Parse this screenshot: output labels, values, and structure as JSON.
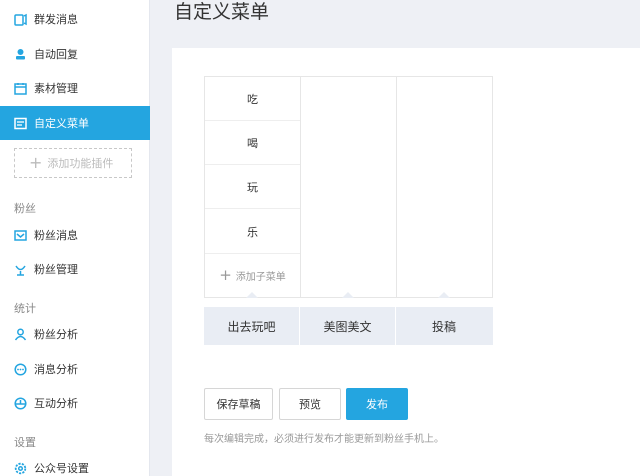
{
  "sidebar": {
    "items": [
      {
        "label": "群发消息",
        "icon": "broadcast-icon"
      },
      {
        "label": "自动回复",
        "icon": "auto-reply-icon"
      },
      {
        "label": "素材管理",
        "icon": "materials-icon"
      },
      {
        "label": "自定义菜单",
        "icon": "custom-menu-icon"
      }
    ],
    "add_plugin_label": "添加功能插件",
    "sections": [
      {
        "label": "粉丝",
        "items": [
          {
            "label": "粉丝消息",
            "icon": "fan-message-icon"
          },
          {
            "label": "粉丝管理",
            "icon": "fan-manage-icon"
          }
        ]
      },
      {
        "label": "统计",
        "items": [
          {
            "label": "粉丝分析",
            "icon": "user-analytics-icon"
          },
          {
            "label": "消息分析",
            "icon": "message-analytics-icon"
          },
          {
            "label": "互动分析",
            "icon": "interaction-analytics-icon"
          }
        ]
      },
      {
        "label": "设置",
        "items": [
          {
            "label": "公众号设置",
            "icon": "account-settings-icon"
          }
        ]
      }
    ],
    "accent": "#24a5e0"
  },
  "header": {
    "title": "自定义菜单"
  },
  "menu": {
    "sub_items": [
      "吃",
      "喝",
      "玩",
      "乐"
    ],
    "add_sub_label": "添加子菜单",
    "top_items": [
      "出去玩吧",
      "美图美文",
      "投稿"
    ]
  },
  "actions": {
    "save_draft": "保存草稿",
    "preview": "预览",
    "publish": "发布"
  },
  "hint": "每次编辑完成，必须进行发布才能更新到粉丝手机上。"
}
